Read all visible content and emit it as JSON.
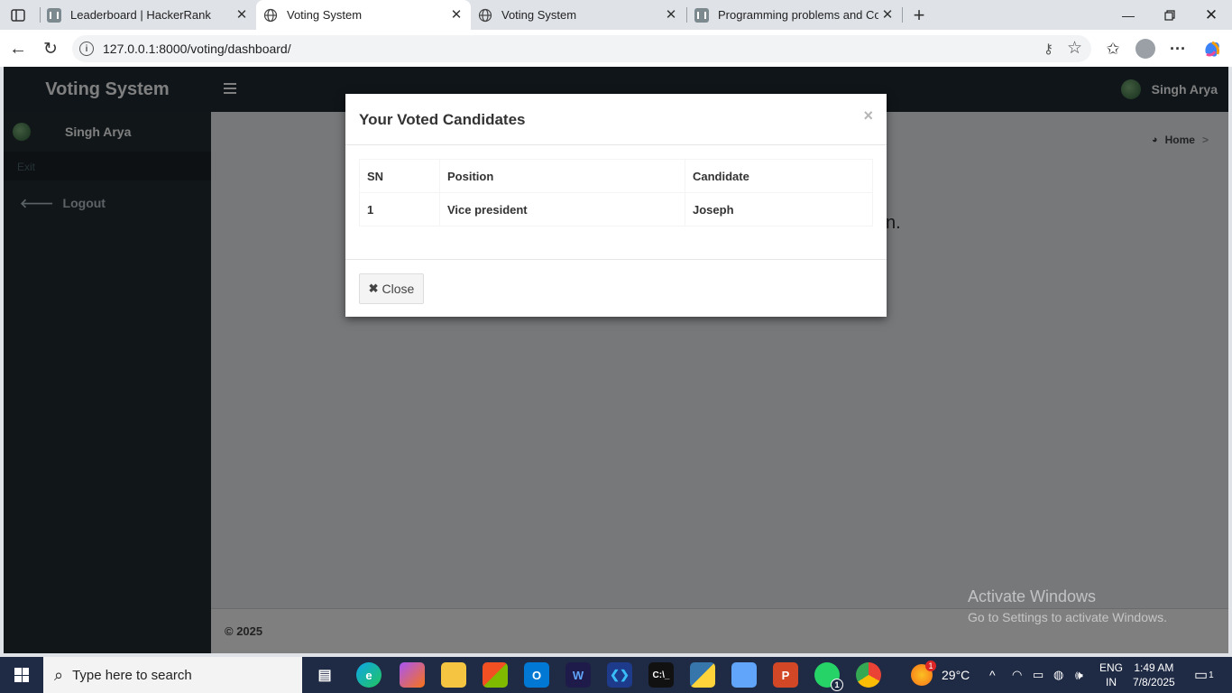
{
  "browser": {
    "tabs": [
      {
        "title": "Leaderboard | HackerRank",
        "icon": "hackerrank-icon",
        "active": false
      },
      {
        "title": "Voting System",
        "icon": "globe-icon",
        "active": true
      },
      {
        "title": "Voting System",
        "icon": "globe-icon",
        "active": false
      },
      {
        "title": "Programming problems and Com",
        "icon": "hackerrank-icon",
        "active": false
      }
    ],
    "url": "127.0.0.1:8000/voting/dashboard/"
  },
  "app": {
    "logo": "Voting System",
    "user_name": "Singh Arya",
    "sidebar": {
      "user_name": "Singh Arya",
      "section_header": "Exit",
      "items": [
        {
          "label": "Logout",
          "icon": "arrow-left-icon"
        }
      ]
    },
    "breadcrumb": {
      "home": "Home"
    },
    "content_fragment": "n.",
    "footer": "© 2025"
  },
  "modal": {
    "title": "Your Voted Candidates",
    "close_x": "×",
    "table": {
      "headers": [
        "SN",
        "Position",
        "Candidate"
      ],
      "rows": [
        [
          "1",
          "Vice president",
          "Joseph"
        ]
      ]
    },
    "close_button": "Close"
  },
  "watermark": {
    "line1": "Activate Windows",
    "line2": "Go to Settings to activate Windows."
  },
  "taskbar": {
    "search_placeholder": "Type here to search",
    "temperature": "29°C",
    "language": "ENG",
    "region": "IN",
    "time": "1:49 AM",
    "date": "7/8/2025",
    "weather_badge": "1",
    "whatsapp_badge": "1",
    "notification_count": "1"
  }
}
